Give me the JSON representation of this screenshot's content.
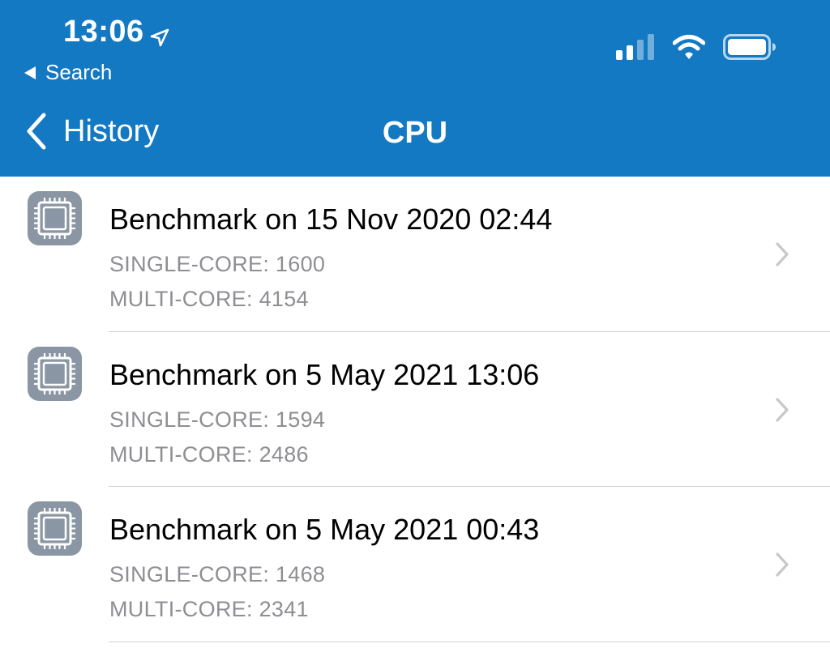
{
  "status_bar": {
    "time": "13:06",
    "back_app_label": "Search"
  },
  "nav": {
    "back_label": "History",
    "title": "CPU"
  },
  "benchmarks": [
    {
      "title": "Benchmark on 15 Nov 2020 02:44",
      "single_core": "SINGLE-CORE: 1600",
      "multi_core": "MULTI-CORE: 4154"
    },
    {
      "title": "Benchmark on 5 May 2021 13:06",
      "single_core": "SINGLE-CORE: 1594",
      "multi_core": "MULTI-CORE: 2486"
    },
    {
      "title": "Benchmark on 5 May 2021 00:43",
      "single_core": "SINGLE-CORE: 1468",
      "multi_core": "MULTI-CORE: 2341"
    }
  ],
  "colors": {
    "header_bg": "#1479c3",
    "icon_bg": "#8a96a3",
    "secondary_text": "#8e8e93",
    "chevron": "#c7c7cc"
  },
  "icons": {
    "row_icon": "cpu-chip-icon",
    "row_accessory": "chevron-right-icon",
    "back": "chevron-left-icon",
    "location": "location-arrow-icon",
    "signal": "cellular-signal-icon",
    "wifi": "wifi-icon",
    "battery": "battery-icon"
  }
}
